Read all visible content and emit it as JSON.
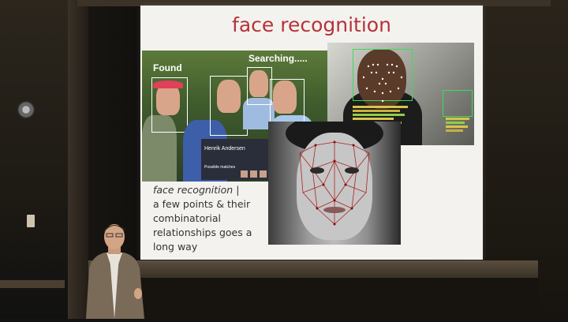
{
  "slide": {
    "title": "face recognition",
    "caption_italic": "face recognition",
    "caption_sep": " |",
    "caption_lines": [
      "a few points & their",
      "combinatorial",
      "relationships goes a",
      "long way"
    ]
  },
  "photo_labels": {
    "found": "Found",
    "searching": "Searching.....",
    "name": "Henrik Andersen",
    "possible_matches": "Possible matches"
  }
}
